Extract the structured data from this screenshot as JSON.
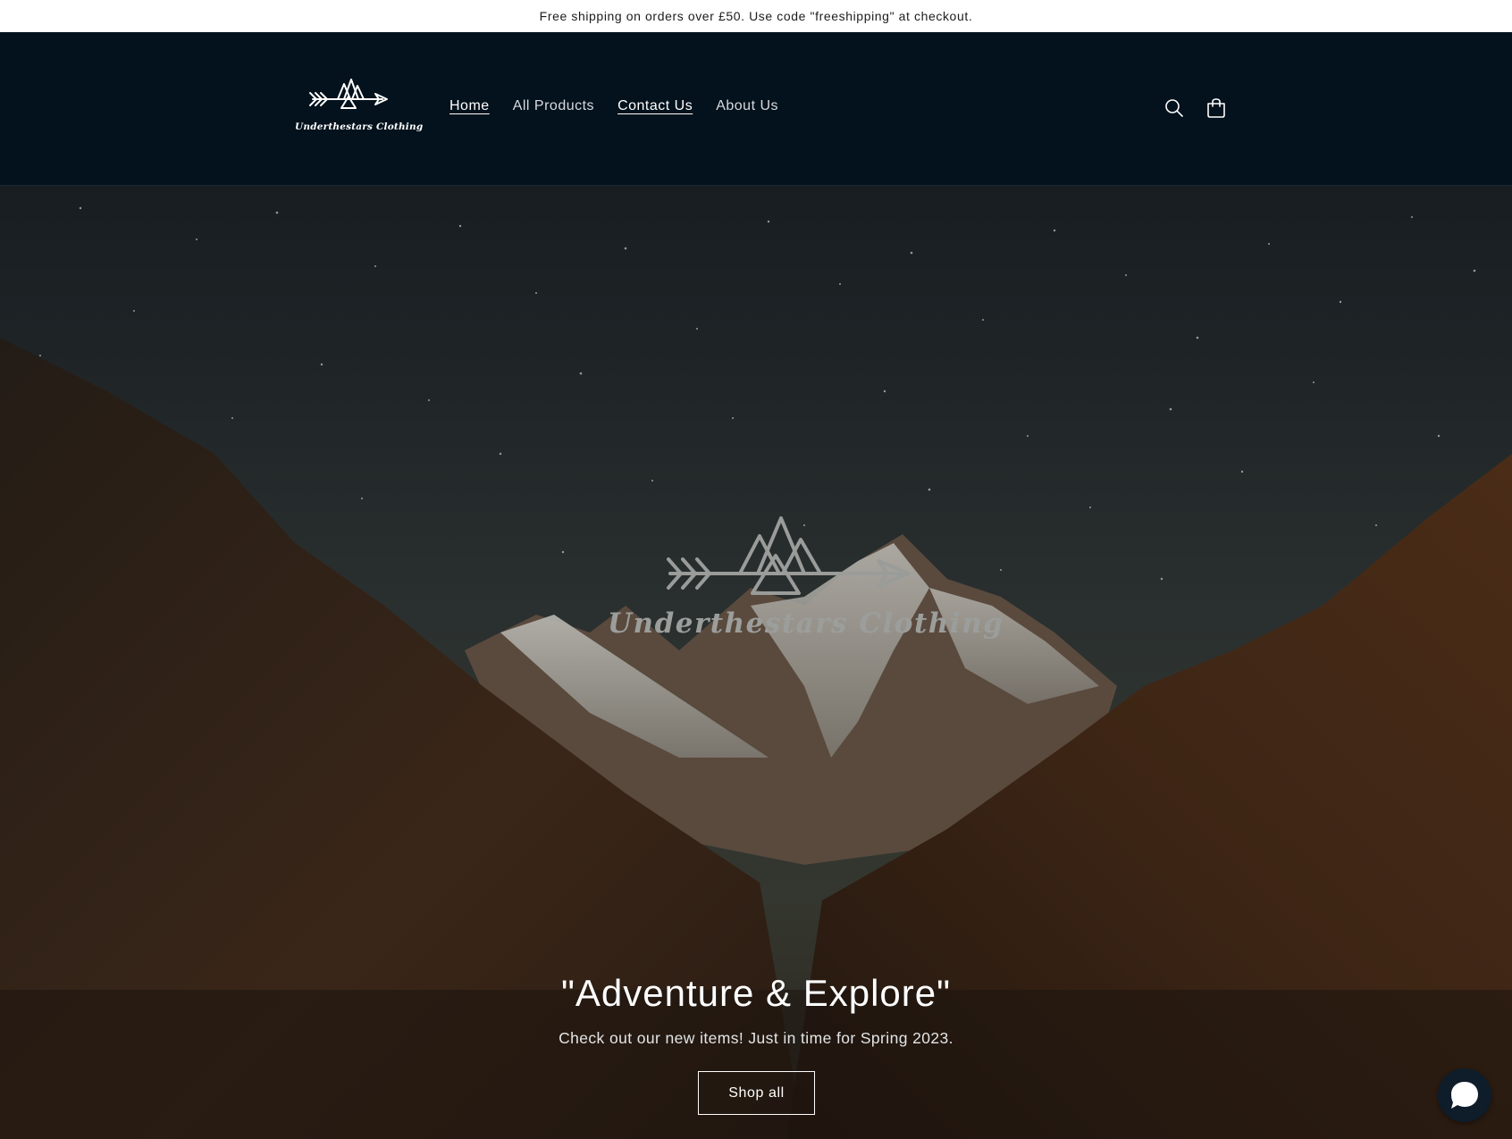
{
  "announcement": {
    "text": "Free shipping on orders over £50. Use code \"freeshipping\" at checkout."
  },
  "header": {
    "logo_text": "Underthestars Clothing",
    "nav": [
      {
        "label": "Home",
        "active": true
      },
      {
        "label": "All Products",
        "active": false
      },
      {
        "label": "Contact Us",
        "active": true
      },
      {
        "label": "About Us",
        "active": false
      }
    ],
    "icons": [
      "search-icon",
      "cart-icon"
    ]
  },
  "hero": {
    "logo_text": "Underthestars Clothing",
    "title": "\"Adventure & Explore\"",
    "subtitle": "Check out our new items! Just in time for Spring 2023.",
    "button_label": "Shop all"
  },
  "chat": {
    "icon": "chat-bubble-icon"
  },
  "colors": {
    "header_bg": "#03121c",
    "announcement_bg": "#ffffff",
    "text_light": "#ffffff"
  }
}
